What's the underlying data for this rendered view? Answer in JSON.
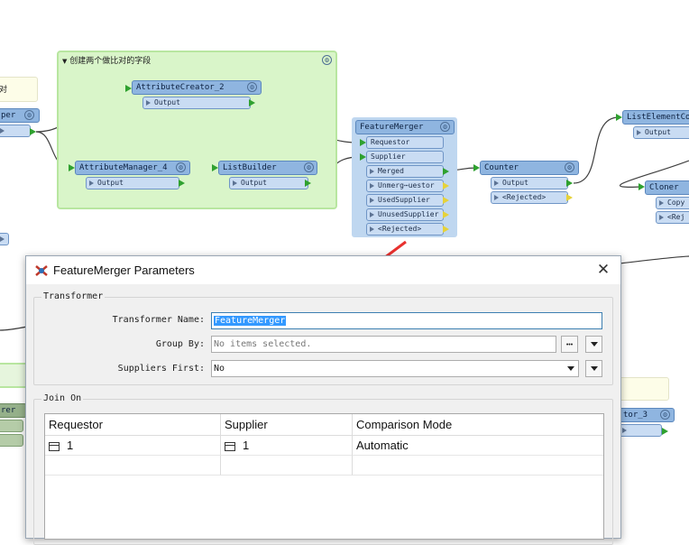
{
  "canvas": {
    "bookmark_title": "创建两个做比对的字段",
    "left_note_text": "对",
    "left_transformer_partial": "per",
    "left_bottom_partial": "rer",
    "right_bottom_partial": "tor_3",
    "transformers": {
      "attribute_creator": {
        "name": "AttributeCreator_2",
        "ports": [
          "Output"
        ]
      },
      "attribute_manager": {
        "name": "AttributeManager_4",
        "ports": [
          "Output"
        ]
      },
      "list_builder": {
        "name": "ListBuilder",
        "ports": [
          "Output"
        ]
      },
      "feature_merger": {
        "name": "FeatureMerger",
        "inputs": [
          "Requestor",
          "Supplier"
        ],
        "outputs": [
          "Merged",
          "Unmerg⋯uestor",
          "UsedSupplier",
          "UnusedSupplier",
          "<Rejected>"
        ]
      },
      "counter": {
        "name": "Counter",
        "ports": [
          "Output",
          "<Rejected>"
        ]
      },
      "list_element_counter": {
        "name": "ListElementCou",
        "ports": [
          "Output"
        ]
      },
      "cloner": {
        "name": "Cloner",
        "ports": [
          "Copy",
          "<Rej"
        ]
      }
    },
    "colors": {
      "node_header": "#8fb5e0",
      "port": "#c9dcf3",
      "bookmark": "#d9f5c9",
      "connected": "#2fa12f",
      "unconnected": "#e6d23a",
      "annotation_arrow": "#e8312e"
    }
  },
  "dialog": {
    "title": "FeatureMerger Parameters",
    "close_glyph": "✕",
    "transformer_section": "Transformer",
    "fields": {
      "transformer_name_label": "Transformer Name:",
      "transformer_name_value": "FeatureMerger",
      "group_by_label": "Group By:",
      "group_by_placeholder": "No items selected.",
      "group_by_button": "•••",
      "suppliers_first_label": "Suppliers First:",
      "suppliers_first_value": "No"
    },
    "join_section": "Join On",
    "table": {
      "headers": [
        "Requestor",
        "Supplier",
        "Comparison Mode"
      ],
      "rows": [
        [
          "1",
          "1",
          "Automatic"
        ]
      ]
    }
  }
}
